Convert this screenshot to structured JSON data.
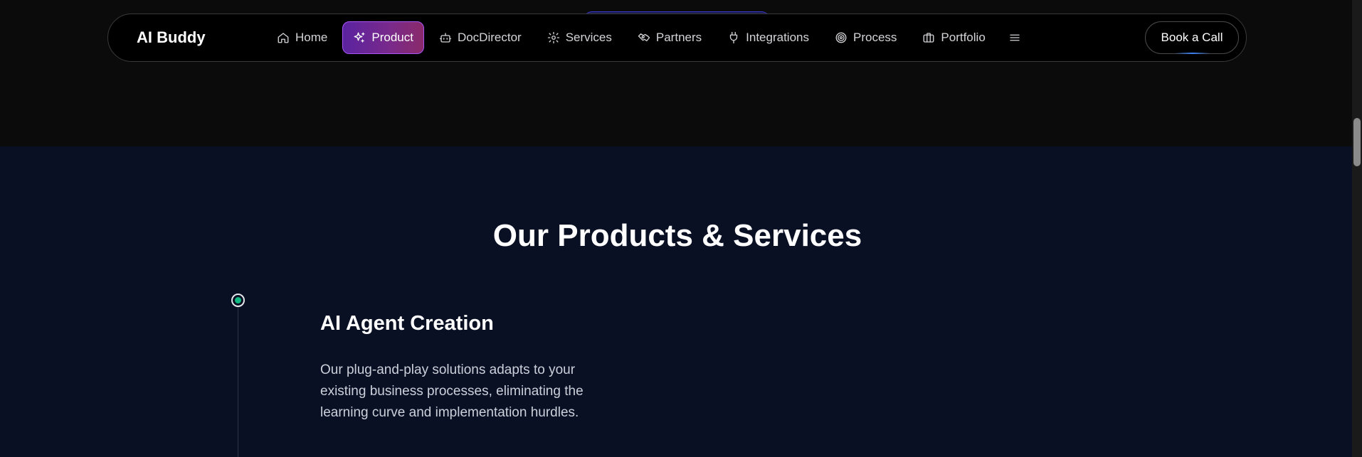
{
  "navbar": {
    "brand": "AI Buddy",
    "items": [
      {
        "label": "Home",
        "icon": "home-icon",
        "active": false
      },
      {
        "label": "Product",
        "icon": "sparkles-icon",
        "active": true
      },
      {
        "label": "DocDirector",
        "icon": "bot-icon",
        "active": false
      },
      {
        "label": "Services",
        "icon": "gear-icon",
        "active": false
      },
      {
        "label": "Partners",
        "icon": "handshake-icon",
        "active": false
      },
      {
        "label": "Integrations",
        "icon": "plug-icon",
        "active": false
      },
      {
        "label": "Process",
        "icon": "target-icon",
        "active": false
      },
      {
        "label": "Portfolio",
        "icon": "briefcase-icon",
        "active": false
      }
    ],
    "menu_icon": "hamburger-menu-icon",
    "cta_label": "Book a Call"
  },
  "section": {
    "title": "Our Products & Services",
    "timeline": {
      "item_title": "AI Agent Creation",
      "item_description": "Our plug-and-play solutions adapts to your existing business processes, eliminating the learning curve and implementation hurdles."
    }
  },
  "colors": {
    "active_nav_gradient_start": "#5b23a0",
    "active_nav_border": "#a855f7",
    "section_background": "#0a1024",
    "timeline_dot": "#10b981"
  }
}
